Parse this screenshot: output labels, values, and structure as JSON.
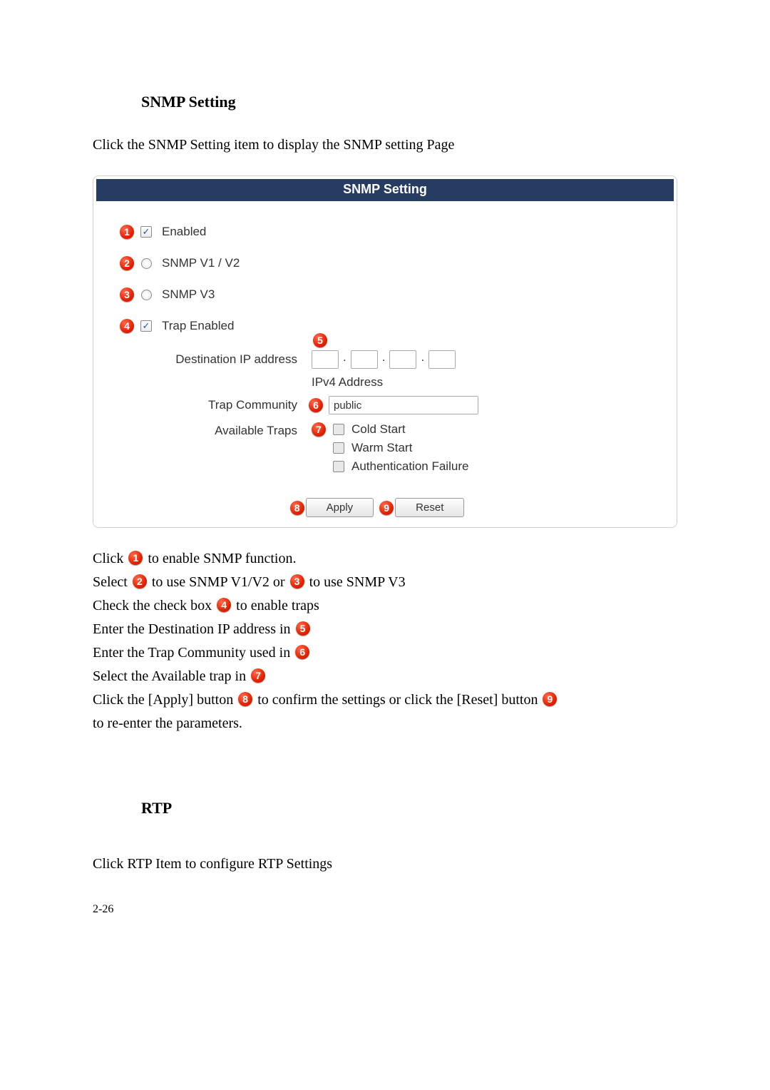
{
  "headings": {
    "snmp": "SNMP Setting",
    "rtp": "RTP"
  },
  "intro": {
    "snmp": "Click the SNMP Setting item to display the SNMP setting Page",
    "rtp": "Click RTP Item to configure RTP Settings"
  },
  "panel": {
    "title": "SNMP Setting",
    "enabled_label": "Enabled",
    "enabled_checked": "✓",
    "snmp_v1v2_label": "SNMP V1 / V2",
    "snmp_v3_label": "SNMP V3",
    "trap_enabled_label": "Trap Enabled",
    "trap_enabled_checked": "✓",
    "dest_ip_label": "Destination IP address",
    "dest_ip_hint": "IPv4 Address",
    "trap_comm_label": "Trap Community",
    "trap_comm_value": "public",
    "avail_traps_label": "Available Traps",
    "traps": {
      "cold": "Cold Start",
      "warm": "Warm Start",
      "auth": "Authentication Failure"
    },
    "apply": "Apply",
    "reset": "Reset"
  },
  "callouts": {
    "n1": "1",
    "n2": "2",
    "n3": "3",
    "n4": "4",
    "n5": "5",
    "n6": "6",
    "n7": "7",
    "n8": "8",
    "n9": "9"
  },
  "instructions": {
    "l1a": "Click ",
    "l1b": " to enable SNMP function.",
    "l2a": "Select ",
    "l2b": "  to use SNMP V1/V2 or  ",
    "l2c": "  to use SNMP V3",
    "l3a": "Check the check box  ",
    "l3b": "    to enable traps",
    "l4a": "Enter the Destination IP address in ",
    "l5a": "Enter the Trap Community used in ",
    "l6a": "Select the Available trap in ",
    "l7a": "Click the [Apply] button   ",
    "l7b": "   to confirm the settings or click the [Reset] button ",
    "l8a": "to re-enter the parameters."
  },
  "footer": "2-26"
}
